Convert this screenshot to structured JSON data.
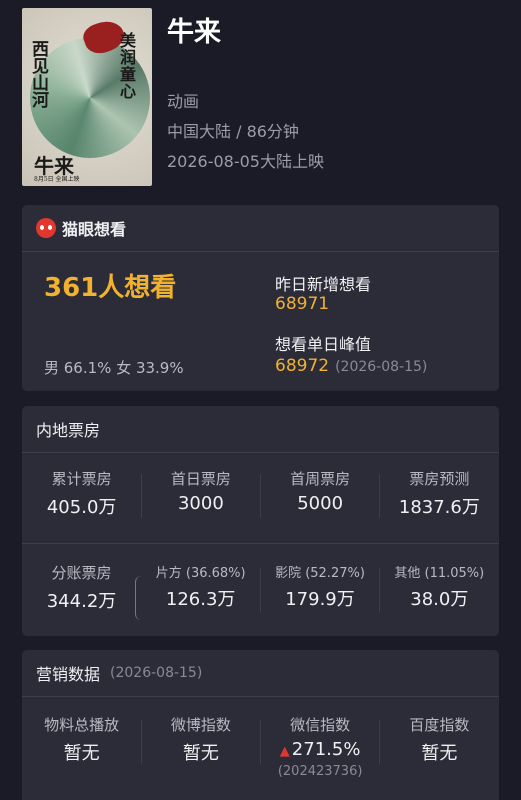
{
  "movie": {
    "title": "牛来",
    "genre": "动画",
    "region_duration": "中国大陆 / 86分钟",
    "release": "2026-08-05大陆上映",
    "poster": {
      "vertical_left": "西见山河",
      "vertical_right": "美润童心",
      "title": "牛来",
      "bottom": "8月5日 全国上映"
    }
  },
  "maoyan": {
    "brand": "猫眼想看",
    "want_count": "361人想看",
    "gender": "男 66.1% 女 33.9%",
    "yesterday_label": "昨日新增想看",
    "yesterday_value": "68971",
    "peak_label": "想看单日峰值",
    "peak_value": "68972",
    "peak_date": "(2026-08-15)"
  },
  "boxoffice": {
    "title": "内地票房",
    "row1": [
      {
        "label": "累计票房",
        "value": "405.0万"
      },
      {
        "label": "首日票房",
        "value": "3000"
      },
      {
        "label": "首周票房",
        "value": "5000"
      },
      {
        "label": "票房预测",
        "value": "1837.6万"
      }
    ],
    "split": {
      "label": "分账票房",
      "value": "344.2万"
    },
    "row2": [
      {
        "label": "片方 (36.68%)",
        "value": "126.3万"
      },
      {
        "label": "影院 (52.27%)",
        "value": "179.9万"
      },
      {
        "label": "其他 (11.05%)",
        "value": "38.0万"
      }
    ]
  },
  "marketing": {
    "title": "营销数据",
    "date": "(2026-08-15)",
    "items": [
      {
        "label": "物料总播放",
        "value": "暂无"
      },
      {
        "label": "微博指数",
        "value": "暂无"
      },
      {
        "label": "微信指数",
        "value": "271.5%",
        "sub": "(202423736)"
      },
      {
        "label": "百度指数",
        "value": "暂无"
      }
    ]
  },
  "colors": {
    "background": "#1b1a27",
    "card": "#2c2c39",
    "accent_gold": "#f2b22e",
    "maoyan_red": "#e2372f"
  },
  "icons": {
    "maoyan_logo": "maoyan-logo-icon",
    "up_arrow": "up-arrow-icon",
    "brace": "brace-icon"
  }
}
